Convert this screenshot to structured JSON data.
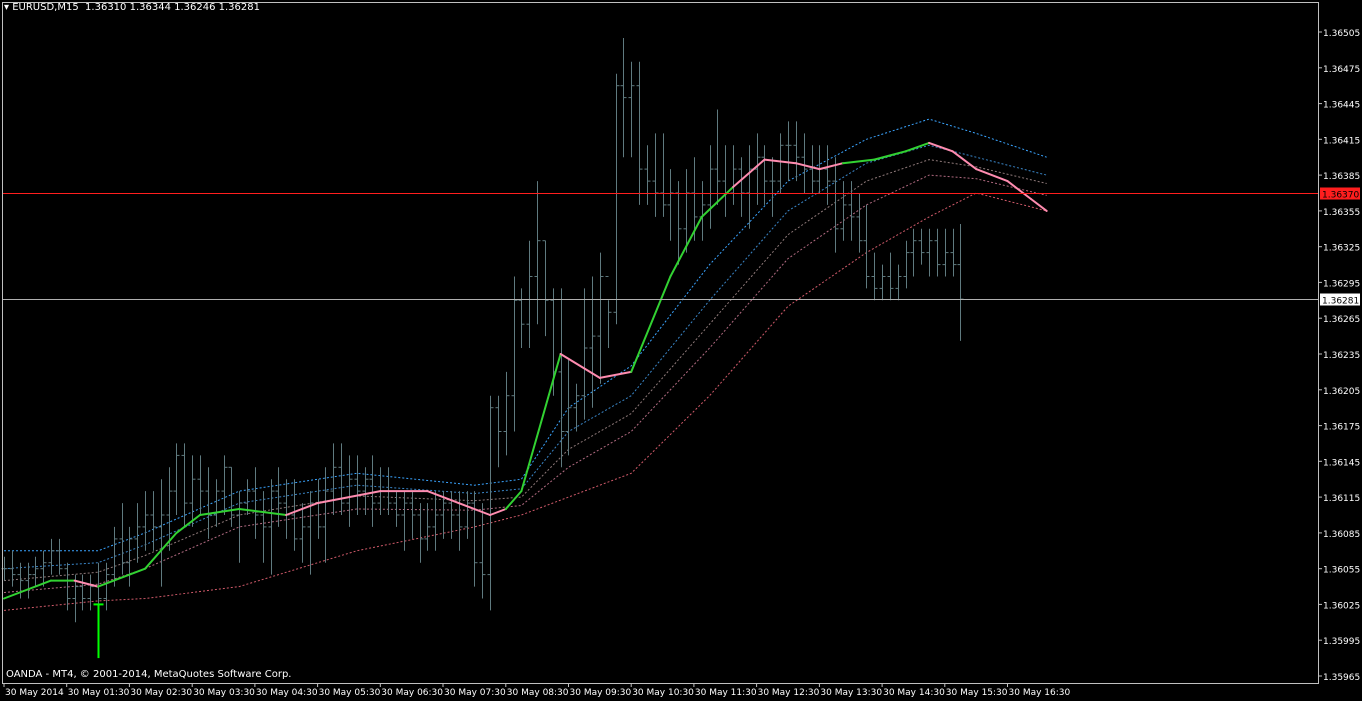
{
  "header": {
    "symbol": "EURUSD,M15",
    "ohlc": "1.36310 1.36344 1.36246 1.36281"
  },
  "footer": {
    "copyright": "OANDA - MT4, © 2001-2014, MetaQuotes Software Corp."
  },
  "colors": {
    "background": "#000000",
    "frame": "#c0c0c0",
    "bars": "#5f7a7f",
    "ma_up": "#32d232",
    "ma_down": "#ff8cb0",
    "band_outer_upper": "#3aa4ff",
    "band_inner_upper": "#3a86c8",
    "band_mid1": "#8f7a7a",
    "band_mid2": "#b06a80",
    "band_lower": "#d05a6a",
    "hline_red": "#ff1e1e",
    "hline_bid": "#b0b0b0",
    "signal_arrow": "#00ff00"
  },
  "chart_data": {
    "type": "ohlc",
    "symbol": "EURUSD",
    "timeframe": "M15",
    "ylim": [
      1.3595,
      1.3652
    ],
    "price_ticks": [
      "1.36505",
      "1.36475",
      "1.36445",
      "1.36415",
      "1.36385",
      "1.36355",
      "1.36325",
      "1.36295",
      "1.36265",
      "1.36235",
      "1.36205",
      "1.36175",
      "1.36145",
      "1.36115",
      "1.36085",
      "1.36055",
      "1.36025",
      "1.35995",
      "1.35965"
    ],
    "time_ticks": [
      "30 May 2014",
      "30 May 01:30",
      "30 May 02:30",
      "30 May 03:30",
      "30 May 04:30",
      "30 May 05:30",
      "30 May 06:30",
      "30 May 07:30",
      "30 May 08:30",
      "30 May 09:30",
      "30 May 10:30",
      "30 May 11:30",
      "30 May 12:30",
      "30 May 13:30",
      "30 May 14:30",
      "30 May 15:30",
      "30 May 16:30"
    ],
    "hlines": [
      {
        "price": 1.3637,
        "label": "1.36370",
        "style": "red"
      },
      {
        "price": 1.36281,
        "label": "1.36281",
        "style": "bid"
      }
    ],
    "bars": [
      [
        1.36055,
        1.36065,
        1.36045,
        1.36055
      ],
      [
        1.36055,
        1.3607,
        1.3604,
        1.3605
      ],
      [
        1.3605,
        1.3606,
        1.3603,
        1.36045
      ],
      [
        1.36045,
        1.3606,
        1.3603,
        1.3605
      ],
      [
        1.3605,
        1.36065,
        1.3604,
        1.36055
      ],
      [
        1.36055,
        1.3607,
        1.3604,
        1.3606
      ],
      [
        1.3606,
        1.3608,
        1.3605,
        1.3607
      ],
      [
        1.3607,
        1.3608,
        1.3605,
        1.36055
      ],
      [
        1.36055,
        1.3606,
        1.3602,
        1.3603
      ],
      [
        1.3603,
        1.3605,
        1.3601,
        1.3604
      ],
      [
        1.3604,
        1.3605,
        1.3602,
        1.3603
      ],
      [
        1.3603,
        1.3605,
        1.3602,
        1.3604
      ],
      [
        1.3604,
        1.3606,
        1.3602,
        1.3603
      ],
      [
        1.3603,
        1.3606,
        1.3602,
        1.3605
      ],
      [
        1.3605,
        1.3609,
        1.3604,
        1.3608
      ],
      [
        1.3608,
        1.3611,
        1.3605,
        1.3606
      ],
      [
        1.3606,
        1.3609,
        1.3604,
        1.3608
      ],
      [
        1.3608,
        1.3611,
        1.3606,
        1.3609
      ],
      [
        1.3609,
        1.3612,
        1.3607,
        1.361
      ],
      [
        1.361,
        1.3612,
        1.3607,
        1.3609
      ],
      [
        1.3609,
        1.3613,
        1.3604,
        1.361
      ],
      [
        1.361,
        1.3614,
        1.3607,
        1.3612
      ],
      [
        1.3612,
        1.3616,
        1.361,
        1.3615
      ],
      [
        1.3615,
        1.3616,
        1.3609,
        1.3611
      ],
      [
        1.3611,
        1.3615,
        1.3609,
        1.3613
      ],
      [
        1.3613,
        1.3615,
        1.361,
        1.3612
      ],
      [
        1.3612,
        1.3614,
        1.3608,
        1.361
      ],
      [
        1.361,
        1.3613,
        1.3609,
        1.3612
      ],
      [
        1.3612,
        1.3615,
        1.361,
        1.3614
      ],
      [
        1.3614,
        1.3614,
        1.3609,
        1.361
      ],
      [
        1.361,
        1.3612,
        1.3606,
        1.3611
      ],
      [
        1.3611,
        1.3613,
        1.361,
        1.3612
      ],
      [
        1.3612,
        1.3614,
        1.3608,
        1.361
      ],
      [
        1.361,
        1.3612,
        1.3606,
        1.3609
      ],
      [
        1.3609,
        1.3613,
        1.3605,
        1.3612
      ],
      [
        1.3612,
        1.3614,
        1.3609,
        1.3611
      ],
      [
        1.3611,
        1.3613,
        1.3608,
        1.361
      ],
      [
        1.361,
        1.3613,
        1.3607,
        1.3608
      ],
      [
        1.3608,
        1.3611,
        1.3606,
        1.3609
      ],
      [
        1.3609,
        1.3612,
        1.3605,
        1.3611
      ],
      [
        1.3611,
        1.3613,
        1.3608,
        1.3609
      ],
      [
        1.3609,
        1.3614,
        1.3606,
        1.3612
      ],
      [
        1.3612,
        1.3616,
        1.361,
        1.3614
      ],
      [
        1.3614,
        1.3616,
        1.361,
        1.3611
      ],
      [
        1.3611,
        1.3615,
        1.3609,
        1.3613
      ],
      [
        1.3613,
        1.3615,
        1.361,
        1.3612
      ],
      [
        1.3612,
        1.3614,
        1.361,
        1.3613
      ],
      [
        1.3613,
        1.3615,
        1.3609,
        1.3611
      ],
      [
        1.3611,
        1.3614,
        1.361,
        1.3612
      ],
      [
        1.3612,
        1.3614,
        1.361,
        1.3611
      ],
      [
        1.3611,
        1.3612,
        1.3609,
        1.361
      ],
      [
        1.361,
        1.3612,
        1.3607,
        1.3611
      ],
      [
        1.3611,
        1.3612,
        1.3608,
        1.361
      ],
      [
        1.361,
        1.3611,
        1.3606,
        1.3608
      ],
      [
        1.3608,
        1.3611,
        1.3607,
        1.3609
      ],
      [
        1.3609,
        1.3612,
        1.3607,
        1.361
      ],
      [
        1.361,
        1.3612,
        1.3608,
        1.3611
      ],
      [
        1.3611,
        1.3612,
        1.3608,
        1.361
      ],
      [
        1.361,
        1.3612,
        1.3607,
        1.3609
      ],
      [
        1.3609,
        1.3612,
        1.3608,
        1.3611
      ],
      [
        1.3611,
        1.3612,
        1.3604,
        1.3606
      ],
      [
        1.3606,
        1.3611,
        1.3603,
        1.3605
      ],
      [
        1.3605,
        1.362,
        1.3602,
        1.3619
      ],
      [
        1.3619,
        1.362,
        1.3614,
        1.3617
      ],
      [
        1.3617,
        1.3622,
        1.3615,
        1.362
      ],
      [
        1.362,
        1.363,
        1.3617,
        1.3628
      ],
      [
        1.3628,
        1.3629,
        1.3624,
        1.3626
      ],
      [
        1.3626,
        1.3633,
        1.3624,
        1.363
      ],
      [
        1.363,
        1.3638,
        1.3626,
        1.3633
      ],
      [
        1.3633,
        1.3633,
        1.3625,
        1.3628
      ],
      [
        1.3628,
        1.3629,
        1.362,
        1.3622
      ],
      [
        1.3622,
        1.3629,
        1.3614,
        1.3617
      ],
      [
        1.3617,
        1.3623,
        1.3615,
        1.3619
      ],
      [
        1.3619,
        1.3621,
        1.3617,
        1.362
      ],
      [
        1.362,
        1.3629,
        1.3618,
        1.3624
      ],
      [
        1.3624,
        1.363,
        1.3619,
        1.3625
      ],
      [
        1.3625,
        1.3632,
        1.3621,
        1.363
      ],
      [
        1.363,
        1.3628,
        1.3624,
        1.3627
      ],
      [
        1.3627,
        1.3647,
        1.3626,
        1.3646
      ],
      [
        1.3646,
        1.365,
        1.364,
        1.3645
      ],
      [
        1.3645,
        1.3648,
        1.364,
        1.3646
      ],
      [
        1.3646,
        1.3648,
        1.3636,
        1.3639
      ],
      [
        1.3639,
        1.3641,
        1.3636,
        1.3638
      ],
      [
        1.3638,
        1.3642,
        1.3635,
        1.3637
      ],
      [
        1.3637,
        1.3642,
        1.3635,
        1.3636
      ],
      [
        1.3636,
        1.3639,
        1.3633,
        1.3637
      ],
      [
        1.3637,
        1.3638,
        1.3631,
        1.3634
      ],
      [
        1.3634,
        1.3639,
        1.3632,
        1.3637
      ],
      [
        1.3637,
        1.364,
        1.3633,
        1.3635
      ],
      [
        1.3635,
        1.3638,
        1.3633,
        1.3636
      ],
      [
        1.3636,
        1.3641,
        1.3634,
        1.3639
      ],
      [
        1.3639,
        1.3644,
        1.3636,
        1.3638
      ],
      [
        1.3638,
        1.3641,
        1.3635,
        1.3637
      ],
      [
        1.3637,
        1.3641,
        1.3636,
        1.3639
      ],
      [
        1.3639,
        1.364,
        1.3635,
        1.3637
      ],
      [
        1.3637,
        1.3641,
        1.3634,
        1.3639
      ],
      [
        1.3639,
        1.3642,
        1.3636,
        1.364
      ],
      [
        1.364,
        1.3641,
        1.3636,
        1.3638
      ],
      [
        1.3638,
        1.364,
        1.3635,
        1.3638
      ],
      [
        1.3638,
        1.3642,
        1.3637,
        1.3641
      ],
      [
        1.3641,
        1.3643,
        1.3638,
        1.3641
      ],
      [
        1.3641,
        1.3643,
        1.3638,
        1.364
      ],
      [
        1.364,
        1.3642,
        1.3637,
        1.3639
      ],
      [
        1.3639,
        1.3641,
        1.3637,
        1.3638
      ],
      [
        1.3638,
        1.3641,
        1.3637,
        1.3639
      ],
      [
        1.3639,
        1.3641,
        1.3636,
        1.3638
      ],
      [
        1.3638,
        1.364,
        1.3632,
        1.3634
      ],
      [
        1.3634,
        1.3638,
        1.3633,
        1.3636
      ],
      [
        1.3636,
        1.3638,
        1.3633,
        1.3635
      ],
      [
        1.3635,
        1.3637,
        1.3632,
        1.3633
      ],
      [
        1.3633,
        1.3636,
        1.3629,
        1.363
      ],
      [
        1.363,
        1.3632,
        1.3628,
        1.3629
      ],
      [
        1.3629,
        1.3631,
        1.3628,
        1.363
      ],
      [
        1.363,
        1.3632,
        1.3628,
        1.3629
      ],
      [
        1.3629,
        1.3631,
        1.3628,
        1.363
      ],
      [
        1.363,
        1.3633,
        1.3629,
        1.3632
      ],
      [
        1.3632,
        1.3634,
        1.363,
        1.3633
      ],
      [
        1.3633,
        1.3634,
        1.3631,
        1.3632
      ],
      [
        1.3632,
        1.3634,
        1.363,
        1.3633
      ],
      [
        1.3633,
        1.3634,
        1.363,
        1.3631
      ],
      [
        1.3631,
        1.3634,
        1.363,
        1.3632
      ],
      [
        1.3632,
        1.3634,
        1.363,
        1.3631
      ],
      [
        1.3631,
        1.36344,
        1.36246,
        1.36281
      ]
    ],
    "ma": [
      {
        "i": 0,
        "v": 1.3603
      },
      {
        "i": 6,
        "v": 1.36045
      },
      {
        "i": 9,
        "v": 1.36045
      },
      {
        "i": 12,
        "v": 1.3604
      },
      {
        "i": 18,
        "v": 1.36055
      },
      {
        "i": 22,
        "v": 1.36085
      },
      {
        "i": 25,
        "v": 1.361
      },
      {
        "i": 30,
        "v": 1.36105
      },
      {
        "i": 36,
        "v": 1.361
      },
      {
        "i": 40,
        "v": 1.3611
      },
      {
        "i": 48,
        "v": 1.3612
      },
      {
        "i": 54,
        "v": 1.3612
      },
      {
        "i": 58,
        "v": 1.3611
      },
      {
        "i": 62,
        "v": 1.361
      },
      {
        "i": 64,
        "v": 1.36105
      },
      {
        "i": 66,
        "v": 1.3612
      },
      {
        "i": 71,
        "v": 1.36235
      },
      {
        "i": 76,
        "v": 1.36215
      },
      {
        "i": 80,
        "v": 1.3622
      },
      {
        "i": 85,
        "v": 1.363
      },
      {
        "i": 89,
        "v": 1.3635
      },
      {
        "i": 93,
        "v": 1.36375
      },
      {
        "i": 97,
        "v": 1.36398
      },
      {
        "i": 101,
        "v": 1.36395
      },
      {
        "i": 104,
        "v": 1.3639
      },
      {
        "i": 107,
        "v": 1.36395
      },
      {
        "i": 111,
        "v": 1.36398
      },
      {
        "i": 115,
        "v": 1.36405
      },
      {
        "i": 118,
        "v": 1.36412
      },
      {
        "i": 121,
        "v": 1.36405
      },
      {
        "i": 124,
        "v": 1.3639
      },
      {
        "i": 128,
        "v": 1.3638
      },
      {
        "i": 131,
        "v": 1.36365
      },
      {
        "i": 133,
        "v": 1.36355
      }
    ],
    "ma_rising_segments": [
      [
        0,
        8
      ],
      [
        12,
        24
      ],
      [
        25,
        33
      ],
      [
        64,
        72
      ],
      [
        80,
        94
      ],
      [
        108,
        118
      ]
    ],
    "bands": [
      {
        "name": "outer_upper",
        "color_key": "band_outer_upper",
        "points": [
          [
            0,
            1.3607
          ],
          [
            12,
            1.3607
          ],
          [
            18,
            1.36085
          ],
          [
            30,
            1.3612
          ],
          [
            45,
            1.36135
          ],
          [
            60,
            1.36125
          ],
          [
            66,
            1.3613
          ],
          [
            72,
            1.3619
          ],
          [
            80,
            1.36225
          ],
          [
            90,
            1.3631
          ],
          [
            100,
            1.3638
          ],
          [
            110,
            1.36415
          ],
          [
            118,
            1.36432
          ],
          [
            124,
            1.3642
          ],
          [
            133,
            1.364
          ]
        ]
      },
      {
        "name": "inner_upper",
        "color_key": "band_inner_upper",
        "points": [
          [
            0,
            1.36055
          ],
          [
            12,
            1.3606
          ],
          [
            18,
            1.36075
          ],
          [
            30,
            1.3611
          ],
          [
            45,
            1.36125
          ],
          [
            60,
            1.36118
          ],
          [
            66,
            1.36122
          ],
          [
            72,
            1.3617
          ],
          [
            80,
            1.362
          ],
          [
            90,
            1.3628
          ],
          [
            100,
            1.36355
          ],
          [
            110,
            1.36395
          ],
          [
            118,
            1.3641
          ],
          [
            124,
            1.364
          ],
          [
            133,
            1.36385
          ]
        ]
      },
      {
        "name": "mid1",
        "color_key": "band_mid1",
        "points": [
          [
            0,
            1.36045
          ],
          [
            12,
            1.36052
          ],
          [
            18,
            1.36066
          ],
          [
            30,
            1.361
          ],
          [
            45,
            1.36116
          ],
          [
            60,
            1.36112
          ],
          [
            66,
            1.36115
          ],
          [
            72,
            1.36155
          ],
          [
            80,
            1.36185
          ],
          [
            90,
            1.3626
          ],
          [
            100,
            1.36335
          ],
          [
            110,
            1.3638
          ],
          [
            118,
            1.36398
          ],
          [
            124,
            1.36392
          ],
          [
            133,
            1.36378
          ]
        ]
      },
      {
        "name": "mid2",
        "color_key": "band_mid2",
        "points": [
          [
            0,
            1.36035
          ],
          [
            12,
            1.36042
          ],
          [
            18,
            1.36055
          ],
          [
            30,
            1.3609
          ],
          [
            45,
            1.36105
          ],
          [
            60,
            1.36104
          ],
          [
            66,
            1.36108
          ],
          [
            72,
            1.3614
          ],
          [
            80,
            1.3617
          ],
          [
            90,
            1.3624
          ],
          [
            100,
            1.36315
          ],
          [
            110,
            1.3636
          ],
          [
            118,
            1.36385
          ],
          [
            124,
            1.36382
          ],
          [
            133,
            1.36368
          ]
        ]
      },
      {
        "name": "lower",
        "color_key": "band_lower",
        "points": [
          [
            0,
            1.3602
          ],
          [
            12,
            1.36028
          ],
          [
            18,
            1.3603
          ],
          [
            30,
            1.3604
          ],
          [
            45,
            1.3607
          ],
          [
            60,
            1.3609
          ],
          [
            66,
            1.361
          ],
          [
            72,
            1.36115
          ],
          [
            80,
            1.36135
          ],
          [
            90,
            1.362
          ],
          [
            100,
            1.36275
          ],
          [
            110,
            1.3632
          ],
          [
            118,
            1.3635
          ],
          [
            124,
            1.3637
          ],
          [
            133,
            1.36355
          ]
        ]
      }
    ],
    "signal_arrow": {
      "i": 12,
      "price": 1.3598,
      "tip": 1.36025
    }
  }
}
